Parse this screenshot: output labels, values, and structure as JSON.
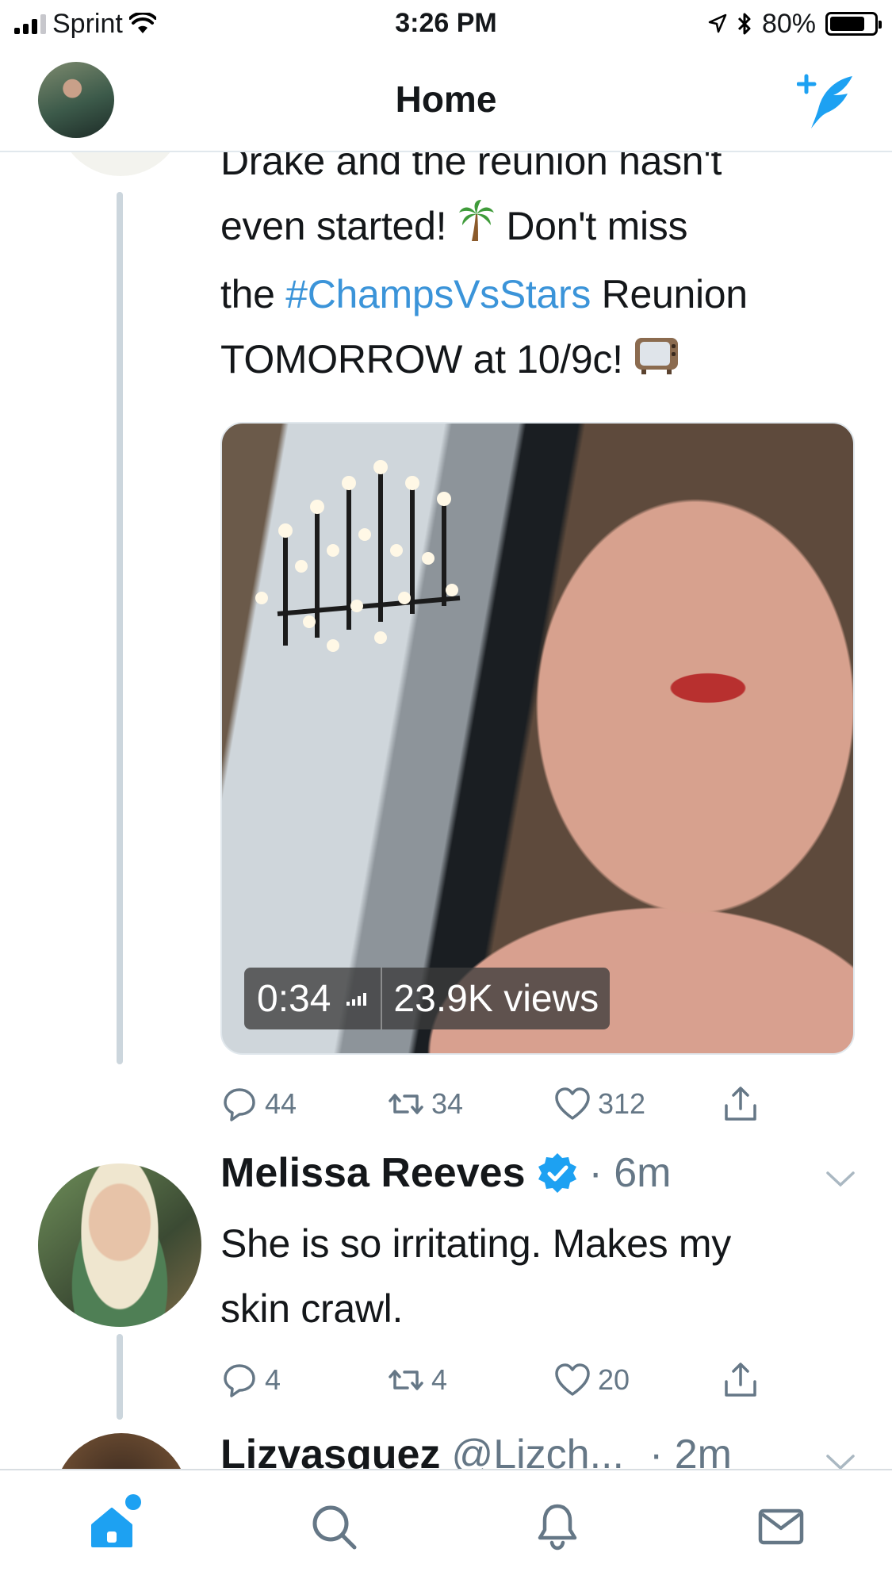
{
  "status_bar": {
    "carrier": "Sprint",
    "time": "3:26 PM",
    "battery_percent": "80%",
    "battery_level": 0.8
  },
  "nav": {
    "title": "Home",
    "avatar_icon": "profile-avatar",
    "compose_icon": "compose-tweet-icon"
  },
  "tweets": [
    {
      "text_lines": [
        {
          "parts": [
            {
              "text": "Drake and the reunion hasn't"
            }
          ]
        },
        {
          "parts": [
            {
              "text": "even started! "
            },
            {
              "emoji": "palm-tree"
            },
            {
              "text": " Don't miss"
            }
          ]
        },
        {
          "parts": [
            {
              "text": "the "
            },
            {
              "hashtag": "#ChampsVsStars"
            },
            {
              "text": " Reunion"
            }
          ]
        },
        {
          "parts": [
            {
              "text": "TOMORROW at 10/9c! "
            },
            {
              "emoji": "television"
            }
          ]
        }
      ],
      "media": {
        "duration": "0:34",
        "views": "23.9K views"
      },
      "actions": {
        "replies": "44",
        "retweets": "34",
        "likes": "312"
      }
    },
    {
      "author_name": "Melissa Reeves",
      "verified": true,
      "time": "· 6m",
      "text_lines": [
        "She is so irritating. Makes my",
        "skin crawl."
      ],
      "actions": {
        "replies": "4",
        "retweets": "4",
        "likes": "20"
      }
    },
    {
      "author_name": "Lizvasquez",
      "handle": "@Lizch...",
      "time": "· 2m"
    }
  ],
  "tabs": [
    {
      "name": "home",
      "icon": "home-icon",
      "active": true
    },
    {
      "name": "search",
      "icon": "search-icon",
      "active": false
    },
    {
      "name": "notifications",
      "icon": "bell-icon",
      "active": false
    },
    {
      "name": "messages",
      "icon": "mail-icon",
      "active": false
    }
  ],
  "colors": {
    "accent": "#1da1f2",
    "text": "#14171a",
    "secondary_text": "#657786",
    "thread_line": "#ccd6dd"
  }
}
